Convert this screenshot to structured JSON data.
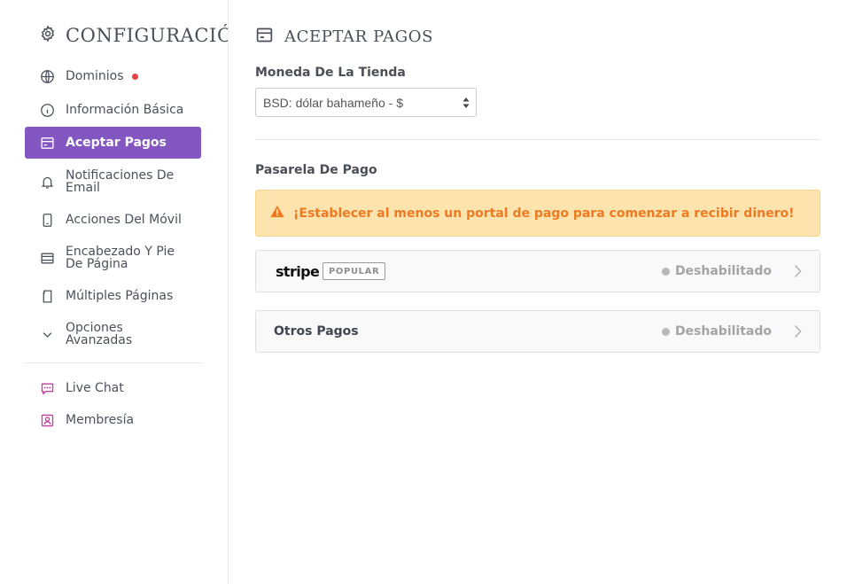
{
  "sidebar": {
    "title": "CONFIGURACIÓN",
    "items": [
      {
        "label": "Dominios",
        "icon": "globe-icon"
      },
      {
        "label": "Información Básica",
        "icon": "info-icon"
      },
      {
        "label": "Aceptar Pagos",
        "icon": "card-icon",
        "active": true
      },
      {
        "label": "Notificaciones De Email",
        "icon": "bell-icon"
      },
      {
        "label": "Acciones Del Móvil",
        "icon": "mobile-icon"
      },
      {
        "label": "Encabezado Y Pie De Página",
        "icon": "layout-icon"
      },
      {
        "label": "Múltiples Páginas",
        "icon": "pages-icon"
      },
      {
        "label": "Opciones Avanzadas",
        "icon": "chevron-down-icon"
      },
      {
        "label": "Live Chat",
        "icon": "chat-icon"
      },
      {
        "label": "Membresía",
        "icon": "member-icon"
      }
    ]
  },
  "main": {
    "title": "ACEPTAR PAGOS",
    "currency_label": "Moneda De La Tienda",
    "currency_value": "BSD: dólar bahameño - $",
    "gateway_label": "Pasarela De Pago",
    "alert": "¡Establecer al menos un portal de pago para comenzar a recibir dinero!",
    "gateways": [
      {
        "name": "stripe",
        "badge": "POPULAR",
        "status": "Deshabilitado"
      },
      {
        "name": "Otros Pagos",
        "status": "Deshabilitado"
      }
    ]
  },
  "colors": {
    "accent": "#8456c2",
    "alert_bg": "#fde3ad",
    "alert_text": "#ee7a22",
    "notification_dot": "#e04444",
    "pink_icon": "#c2409c"
  }
}
